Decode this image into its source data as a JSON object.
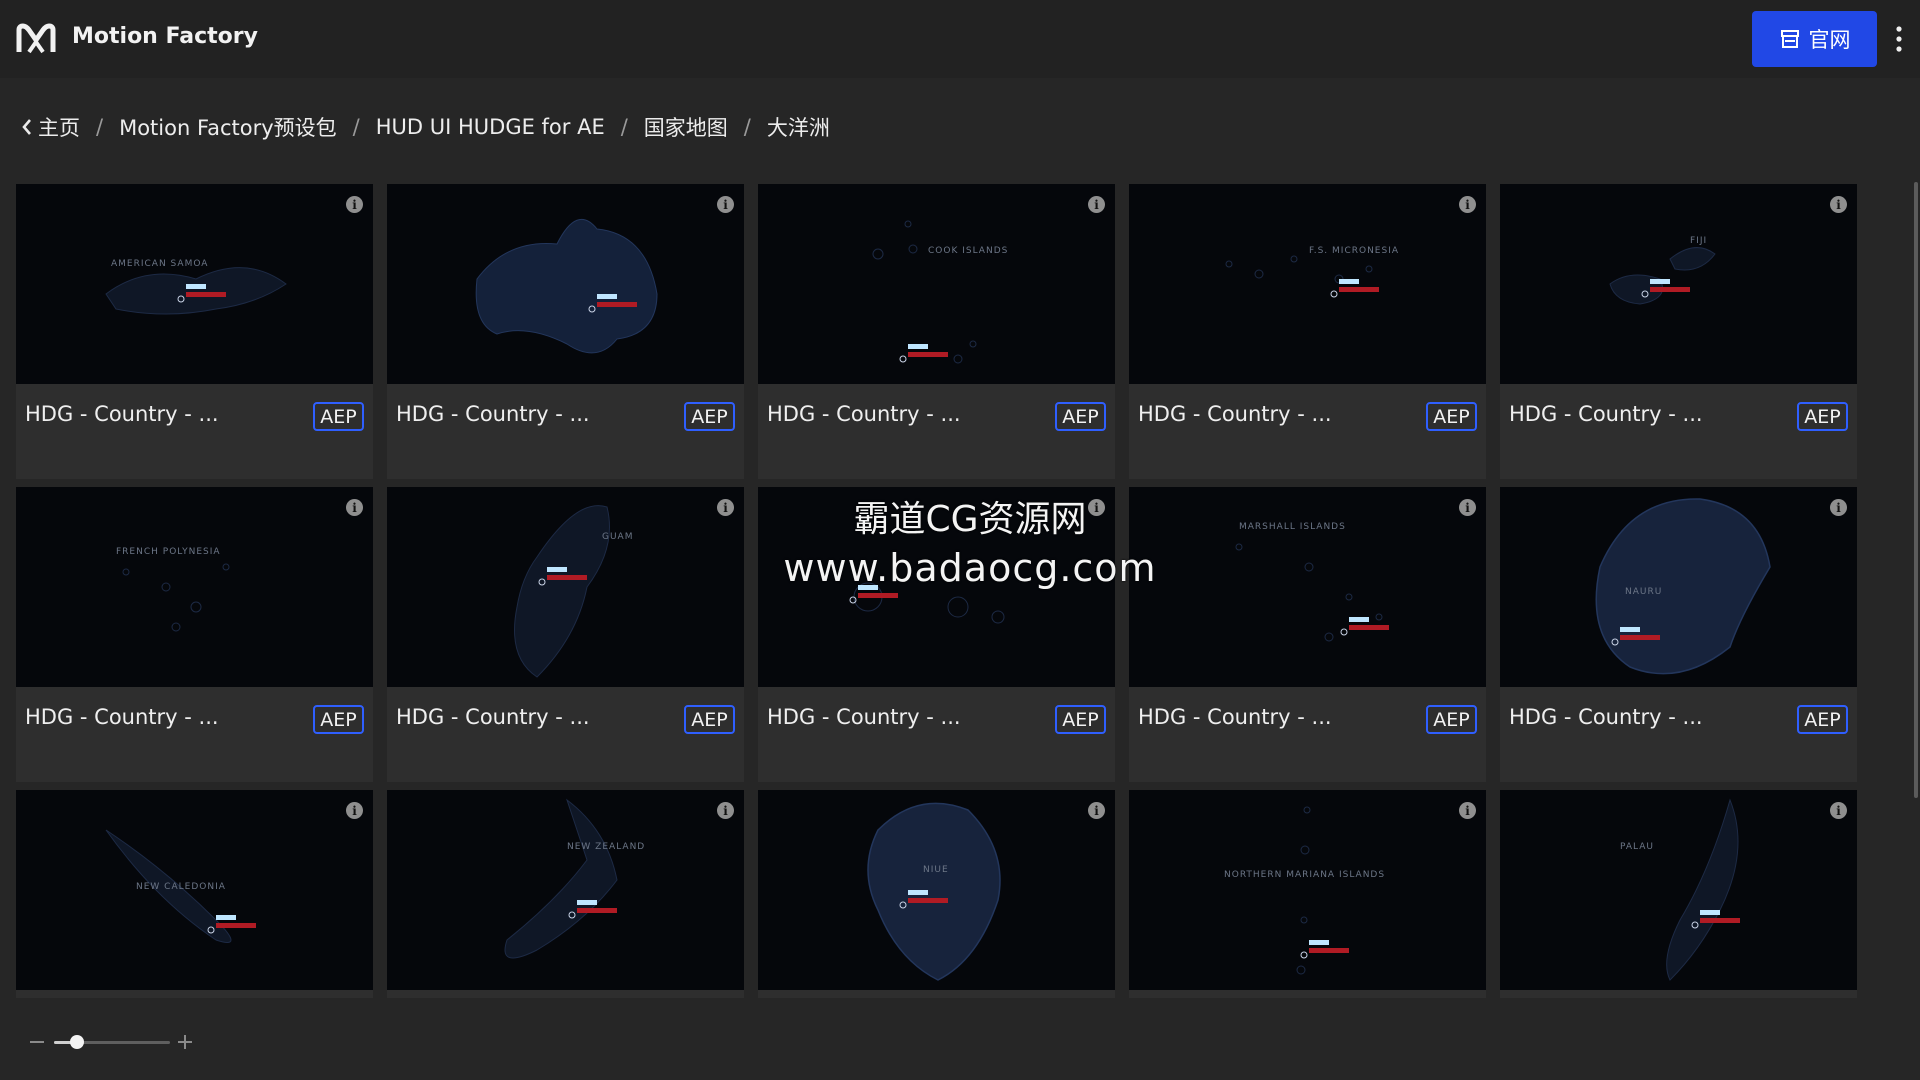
{
  "app": {
    "title": "Motion Factory",
    "site_button_label": "官网"
  },
  "breadcrumb": [
    {
      "label": "主页"
    },
    {
      "label": "Motion Factory预设包"
    },
    {
      "label": "HUD UI HUDGE for AE"
    },
    {
      "label": "国家地图"
    },
    {
      "label": "大洋洲"
    }
  ],
  "breadcrumb_separator": "/",
  "assets": [
    {
      "title": "HDG - Country - ...",
      "badge": "AEP",
      "map_label": "AMERICAN SAMOA"
    },
    {
      "title": "HDG - Country - ...",
      "badge": "AEP",
      "map_label": ""
    },
    {
      "title": "HDG - Country - ...",
      "badge": "AEP",
      "map_label": "COOK ISLANDS"
    },
    {
      "title": "HDG - Country - ...",
      "badge": "AEP",
      "map_label": "F.S. MICRONESIA"
    },
    {
      "title": "HDG - Country - ...",
      "badge": "AEP",
      "map_label": "FIJI"
    },
    {
      "title": "HDG - Country - ...",
      "badge": "AEP",
      "map_label": "FRENCH POLYNESIA"
    },
    {
      "title": "HDG - Country - ...",
      "badge": "AEP",
      "map_label": "GUAM"
    },
    {
      "title": "HDG - Country - ...",
      "badge": "AEP",
      "map_label": ""
    },
    {
      "title": "HDG - Country - ...",
      "badge": "AEP",
      "map_label": "MARSHALL ISLANDS"
    },
    {
      "title": "HDG - Country - ...",
      "badge": "AEP",
      "map_label": "NAURU"
    },
    {
      "title": "",
      "badge": "",
      "map_label": "NEW CALEDONIA"
    },
    {
      "title": "",
      "badge": "",
      "map_label": "NEW ZEALAND"
    },
    {
      "title": "",
      "badge": "",
      "map_label": "NIUE"
    },
    {
      "title": "",
      "badge": "",
      "map_label": "NORTHERN MARIANA ISLANDS"
    },
    {
      "title": "",
      "badge": "",
      "map_label": "PALAU"
    }
  ],
  "zoom": {
    "level": 0.2
  },
  "watermark": {
    "line1": "霸道CG资源网",
    "line2": "www.badaocg.com"
  },
  "colors": {
    "accent": "#2148e6",
    "badge_border": "#2f5fff",
    "thumb_bg": "#05070b",
    "map_fill": "#17233c",
    "marker_red": "#b01b24"
  }
}
